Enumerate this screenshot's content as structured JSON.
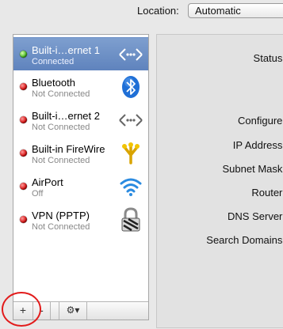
{
  "location": {
    "label": "Location:",
    "value": "Automatic"
  },
  "services": [
    {
      "name": "Built-i…ernet 1",
      "status": "Connected",
      "status_color": "green",
      "icon": "ethernet-icon",
      "selected": true
    },
    {
      "name": "Bluetooth",
      "status": "Not Connected",
      "status_color": "red",
      "icon": "bluetooth-icon",
      "selected": false
    },
    {
      "name": "Built-i…ernet 2",
      "status": "Not Connected",
      "status_color": "red",
      "icon": "ethernet-icon",
      "selected": false
    },
    {
      "name": "Built-in FireWire",
      "status": "Not Connected",
      "status_color": "red",
      "icon": "firewire-icon",
      "selected": false
    },
    {
      "name": "AirPort",
      "status": "Off",
      "status_color": "red",
      "icon": "wifi-icon",
      "selected": false
    },
    {
      "name": "VPN (PPTP)",
      "status": "Not Connected",
      "status_color": "red",
      "icon": "vpn-lock-icon",
      "selected": false
    }
  ],
  "toolbar": {
    "add_label": "+",
    "remove_label": "-",
    "action_label": "⚙▾"
  },
  "details": {
    "status": "Status:",
    "configure": "Configure:",
    "ip_address": "IP Address:",
    "subnet_mask": "Subnet Mask:",
    "router": "Router:",
    "dns_server": "DNS Server:",
    "search_domains": "Search Domains:"
  },
  "colors": {
    "selection": "#6a8cc4",
    "connected": "#46b81f",
    "disconnected": "#d40f0f",
    "annotation_circle": "#e21b1b"
  }
}
